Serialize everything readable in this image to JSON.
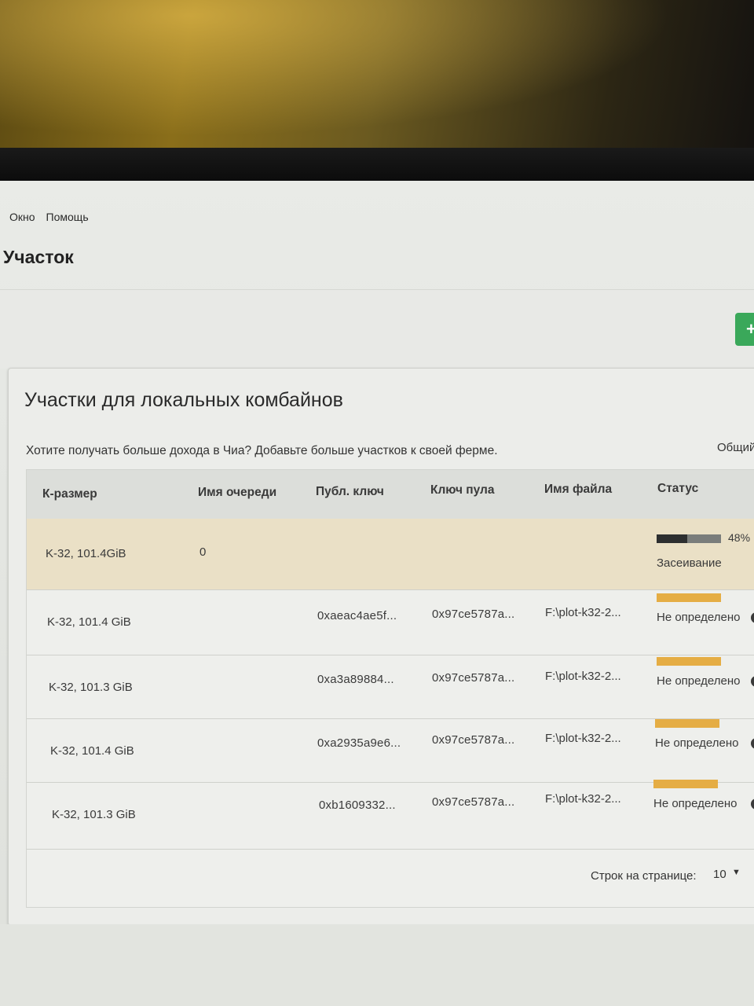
{
  "menu": {
    "items": [
      "Окно",
      "Помощь"
    ]
  },
  "page": {
    "title": "Участок"
  },
  "card": {
    "title": "Участки для локальных комбайнов",
    "subtitle": "Хотите получать больше дохода в Чиа? Добавьте больше участков к своей ферме.",
    "total_label": "Общий"
  },
  "table": {
    "headers": [
      "К-размер",
      "Имя очереди",
      "Публ. ключ",
      "Ключ пула",
      "Имя файла",
      "Статус"
    ],
    "rows": [
      {
        "size": "K-32, 101.4GiB",
        "queue": "0",
        "pubkey": "",
        "poolkey": "",
        "filename": "",
        "status": "Засеивание",
        "progress_label": "48%",
        "progress": 0.48
      },
      {
        "size": "K-32, 101.4 GiB",
        "queue": "",
        "pubkey": "0xaeac4ae5f...",
        "poolkey": "0x97ce5787a...",
        "filename": "F:\\plot-k32-2...",
        "status": "Не определено"
      },
      {
        "size": "K-32, 101.3 GiB",
        "queue": "",
        "pubkey": "0xa3a89884...",
        "poolkey": "0x97ce5787a...",
        "filename": "F:\\plot-k32-2...",
        "status": "Не определено"
      },
      {
        "size": "K-32, 101.4 GiB",
        "queue": "",
        "pubkey": "0xa2935a9e6...",
        "poolkey": "0x97ce5787a...",
        "filename": "F:\\plot-k32-2...",
        "status": "Не определено"
      },
      {
        "size": "K-32, 101.3 GiB",
        "queue": "",
        "pubkey": "0xb1609332...",
        "poolkey": "0x97ce5787a...",
        "filename": "F:\\plot-k32-2...",
        "status": "Не определено"
      }
    ],
    "footer": {
      "rows_per_page_label": "Строк на странице:",
      "rows_per_page_value": "10"
    }
  },
  "colors": {
    "accent": "#3aa85a",
    "status_bar": "#e5ad44",
    "active_row": "#eae0c6"
  },
  "icons": {
    "add": "plus-icon",
    "help": "help-circle-icon",
    "dropdown": "caret-down-icon"
  }
}
